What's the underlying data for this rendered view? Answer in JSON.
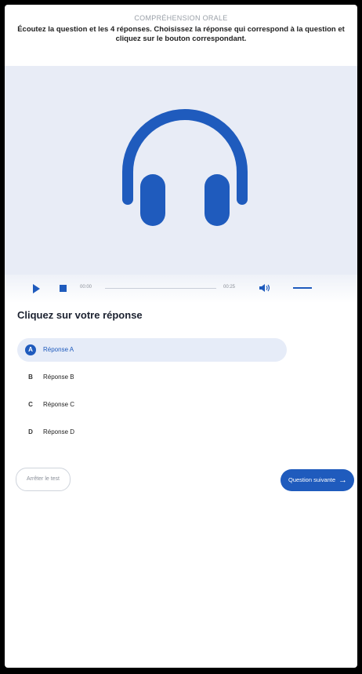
{
  "header": {
    "section_title": "COMPRÉHENSION ORALE",
    "instructions": "Écoutez la question et les 4 réponses. Choisissez la réponse qui correspond à la question et cliquez sur le bouton correspondant."
  },
  "media": {
    "icon": "headphones-icon",
    "accent_color": "#1f5bbd",
    "background_color": "#e8ecf6"
  },
  "player": {
    "current_time": "00:00",
    "total_time": "00:25",
    "progress_fraction": 0,
    "volume_fraction": 1
  },
  "answers": {
    "title": "Cliquez sur votre réponse",
    "options": [
      {
        "letter": "A",
        "label": "Réponse A",
        "selected": true
      },
      {
        "letter": "B",
        "label": "Réponse B",
        "selected": false
      },
      {
        "letter": "C",
        "label": "Réponse C",
        "selected": false
      },
      {
        "letter": "D",
        "label": "Réponse D",
        "selected": false
      }
    ]
  },
  "footer": {
    "stop_label": "Arrêter le test",
    "next_label": "Question suivante",
    "next_icon": "arrow-right-icon"
  }
}
